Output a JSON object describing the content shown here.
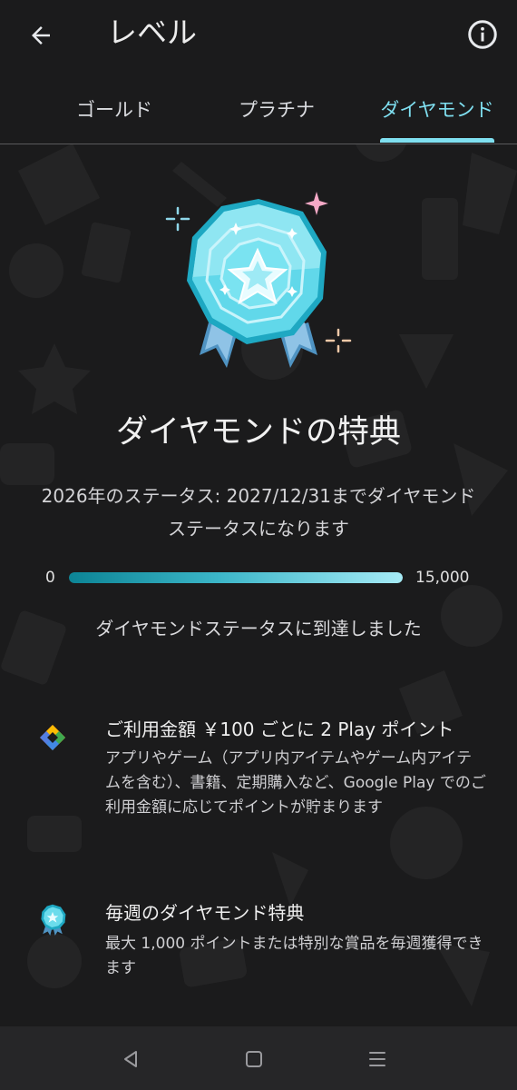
{
  "header": {
    "title": "レベル",
    "back_icon": "arrow-back-icon",
    "info_icon": "info-icon"
  },
  "tabs": [
    {
      "label": "ゴールド",
      "selected": false
    },
    {
      "label": "プラチナ",
      "selected": false
    },
    {
      "label": "ダイヤモンド",
      "selected": true
    }
  ],
  "hero": {
    "badge_icon": "diamond-medal-icon",
    "title": "ダイヤモンドの特典",
    "status": "2026年のステータス: 2027/12/31までダイヤモンドステータスになります"
  },
  "progress": {
    "min_label": "0",
    "max_label": "15,000",
    "fraction": 1.0,
    "reached_text": "ダイヤモンドステータスに到達しました"
  },
  "benefits": [
    {
      "icon": "google-play-points-icon",
      "title": "ご利用金額 ￥100 ごとに 2 Play ポイント",
      "description": "アプリやゲーム（アプリ内アイテムやゲーム内アイテムを含む）、書籍、定期購入など、Google Play でのご利用金額に応じてポイントが貯まります"
    },
    {
      "icon": "diamond-medal-small-icon",
      "title": "毎週のダイヤモンド特典",
      "description": "最大 1,000 ポイントまたは特別な賞品を毎週獲得できます"
    }
  ],
  "colors": {
    "background": "#1b1b1c",
    "accent": "#7fdff0",
    "navbar": "#262628"
  },
  "system_nav": {
    "back_icon": "nav-back-triangle-icon",
    "home_icon": "nav-home-square-icon",
    "menu_icon": "nav-recents-lines-icon"
  }
}
